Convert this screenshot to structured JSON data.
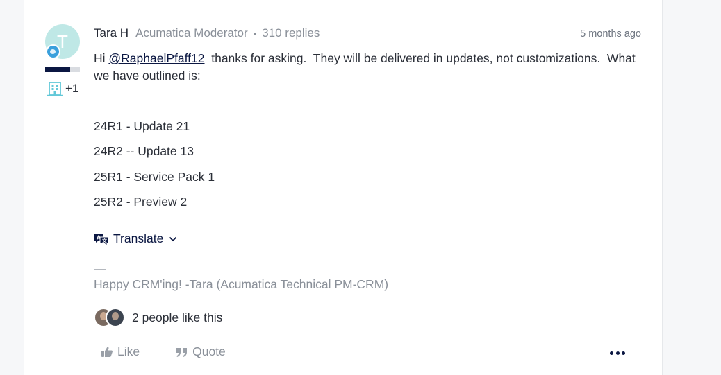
{
  "post": {
    "avatar_initial": "T",
    "author": "Tara H",
    "role": "Acumatica Moderator",
    "separator": "•",
    "replies": "310 replies",
    "timestamp": "5 months ago",
    "rank_progress": 0.72,
    "company_count": "+1",
    "body": {
      "greeting": "Hi ",
      "mention": "@RaphaelPfaff12",
      "text": "  thanks for asking.  They will be delivered in updates, not customizations.  What we have outlined is:"
    },
    "list": [
      "24R1 - Update 21",
      "24R2 -- Update 13",
      "25R1 - Service Pack 1",
      "25R2 - Preview 2"
    ],
    "translate_label": "Translate",
    "signature_dash": "—",
    "signature": "Happy CRM'ing! -Tara (Acumatica Technical PM-CRM)",
    "likes_text": "2 people like this",
    "actions": {
      "like_label": "Like",
      "quote_label": "Quote"
    }
  },
  "colors": {
    "accent": "#0b1742",
    "muted": "#8a9099",
    "avatar_bg": "#bfe8e6",
    "badge": "#3aa0dc",
    "company_icon": "#63c8d8"
  },
  "icons": {
    "badge": "community-badge-icon",
    "company": "building-icon",
    "translate": "translate-icon",
    "chevron": "chevron-down-icon",
    "like": "thumbs-up-icon",
    "quote": "quote-icon",
    "more": "more-options-icon"
  }
}
